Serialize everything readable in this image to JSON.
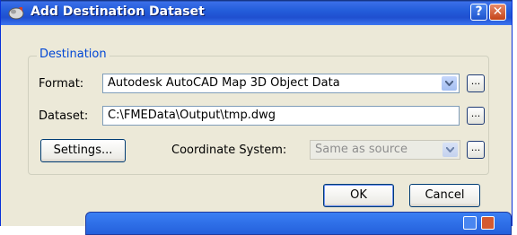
{
  "window": {
    "title": "Add Destination Dataset",
    "help_label": "?",
    "close_label": "✕",
    "icon": "fme-dataset-icon"
  },
  "group": {
    "label": "Destination"
  },
  "format": {
    "label": "Format:",
    "value": "Autodesk AutoCAD Map 3D Object Data",
    "browse_label": "..."
  },
  "dataset": {
    "label": "Dataset:",
    "value": "C:\\FMEData\\Output\\tmp.dwg",
    "browse_label": "..."
  },
  "settings_button": {
    "label": "Settings..."
  },
  "coordinate_system": {
    "label": "Coordinate System:",
    "value": "Same as source",
    "browse_label": "..."
  },
  "buttons": {
    "ok": "OK",
    "cancel": "Cancel"
  },
  "colors": {
    "title_bar": "#245edb",
    "dialog_bg": "#ece9d8",
    "group_label": "#0046d5"
  }
}
